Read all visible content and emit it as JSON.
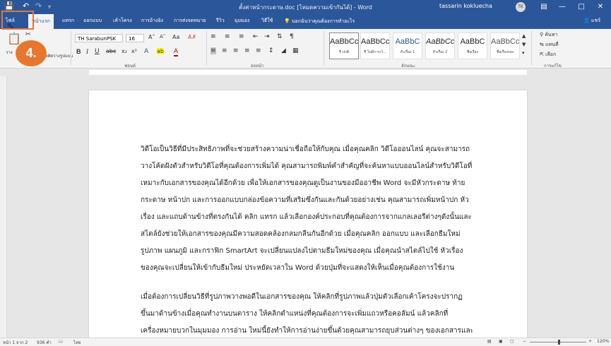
{
  "titlebar": {
    "title": "ตั้งค่าหน้ากระดาษ.doc [โหมดความเข้ากันได้] - Word",
    "user": "tassarin kokluecha",
    "avatar_initials": "TK",
    "icons": [
      "save-icon",
      "undo-icon",
      "redo-icon",
      "customize-icon"
    ],
    "window_buttons": [
      "ribbon-display-icon",
      "minimize-icon",
      "maximize-icon",
      "close-icon"
    ]
  },
  "tabs": [
    "ไฟล์",
    "หน้าแรก",
    "แทรก",
    "ออกแบบ",
    "เค้าโครง",
    "การอ้างอิง",
    "การส่งจดหมาย",
    "รีวิว",
    "มุมมอง",
    "วิธีใช้"
  ],
  "tell_me": "บอกฉันว่าคุณต้องการทำอะไร",
  "share": "แชร์",
  "ribbon": {
    "clipboard": {
      "paste": "วาง",
      "format_painter": "ตัวคัดวางรูปแบบ"
    },
    "font": {
      "name": "TH SarabunPSK",
      "size": "16",
      "label": "ฟอนต์"
    },
    "paragraph": {
      "label": "ย่อหน้า"
    },
    "styles": {
      "label": "ลักษณะ",
      "items": [
        {
          "sample": "AaBbCc",
          "name": "¶ ปกติ"
        },
        {
          "sample": "AaBbCc",
          "name": "¶ ไม่มีการเว้..."
        },
        {
          "sample": "AaBbC",
          "name": "หัวเรื่อง 1"
        },
        {
          "sample": "AaBbCc",
          "name": "หัวเรื่อง 2"
        },
        {
          "sample": "AaBbC",
          "name": "ชื่อเรื่อง"
        },
        {
          "sample": "AaBbCcD",
          "name": "ชื่อเรื่องรอง"
        }
      ]
    },
    "editing": {
      "find": "ค้นหา",
      "replace": "แทนที่",
      "select": "เลือก",
      "label": "การแก้ไข"
    }
  },
  "document": {
    "paragraph1": [
      "วิดีโอเป็นวิธีที่มีประสิทธิภาพที่จะช่วยสร้างความน่าเชื่อถือให้กับคุณ เมื่อคุณคลิก วิดีโอออนไลน์  คุณจะสามารถ",
      "วางโค้ดฝังตัวสำหรับวิดีโอที่คุณต้องการเพิ่มได้ คุณสามารถพิมพ์คำสำคัญที่จะค้นหาแบบออนไลน์สำหรับวิดีโอที่",
      "เหมาะกับเอกสารของคุณได้อีกด้วย เพื่อให้เอกสารของคุณดูเป็นงานของมืออาชีพ Word จะมีหัวกระดาษ ท้าย",
      "กระดาษ หน้าปก และการออกแบบกล่องข้อความที่เสริมซึ่งกันและกันด้วยอย่างเช่น คุณสามารถเพิ่มหน้าปก หัว",
      "เรื่อง และแถบด้านข้างที่ตรงกันได้ คลิก แทรก แล้วเลือกองค์ประกอบที่คุณต้องการจากแกลเลอรีต่างๆดังนั้นและ",
      "สไตล์ยังช่วยให้เอกสารของคุณมีความสอดคล้องกลมกลืนกันอีกด้วย เมื่อคุณคลิก ออกแบบ และเลือกธีมใหม่",
      "รูปภาพ แผนภูมิ และกราฟิก SmartArt จะเปลี่ยนแปลงไปตามธีมใหม่ของคุณ เมื่อคุณนำสไตล์ไปใช้ หัวเรื่อง",
      "ของคุณจะเปลี่ยนให้เข้ากับธีมใหม่ ประหยัดเวลาใน Word ด้วยปุ่มที่จะแสดงให้เห็นเมื่อคุณต้องการใช้งาน"
    ],
    "paragraph2": [
      "เมื่อต้องการเปลี่ยนวิธีที่รูปภาพวางพอดีในเอกสารของคุณ ให้คลิกที่รูปภาพแล้วปุ่มตัวเลือกเค้าโครงจะปรากฏ",
      "ขึ้นมาด้านข้างเมื่อคุณทำงานบนตาราง ให้คลิกตำแหน่งที่คุณต้องการจะเพิ่มแถวหรือคอลัมน์ แล้วคลิกที่",
      "เครื่องหมายบวกในมุมมอง การอ่าน ใหม่นี้ยังทำให้การอ่านง่ายขึ้นด้วยคุณสามารถยุบส่วนต่างๆ ของเอกสารและ"
    ]
  },
  "status": {
    "page": "หน้า 1 จาก 2",
    "words": "936 คำ",
    "language": "ไทย",
    "zoom": "120%"
  },
  "annotation": {
    "step": "4."
  },
  "colors": {
    "accent": "#2b579a",
    "highlight": "#e8772e"
  }
}
